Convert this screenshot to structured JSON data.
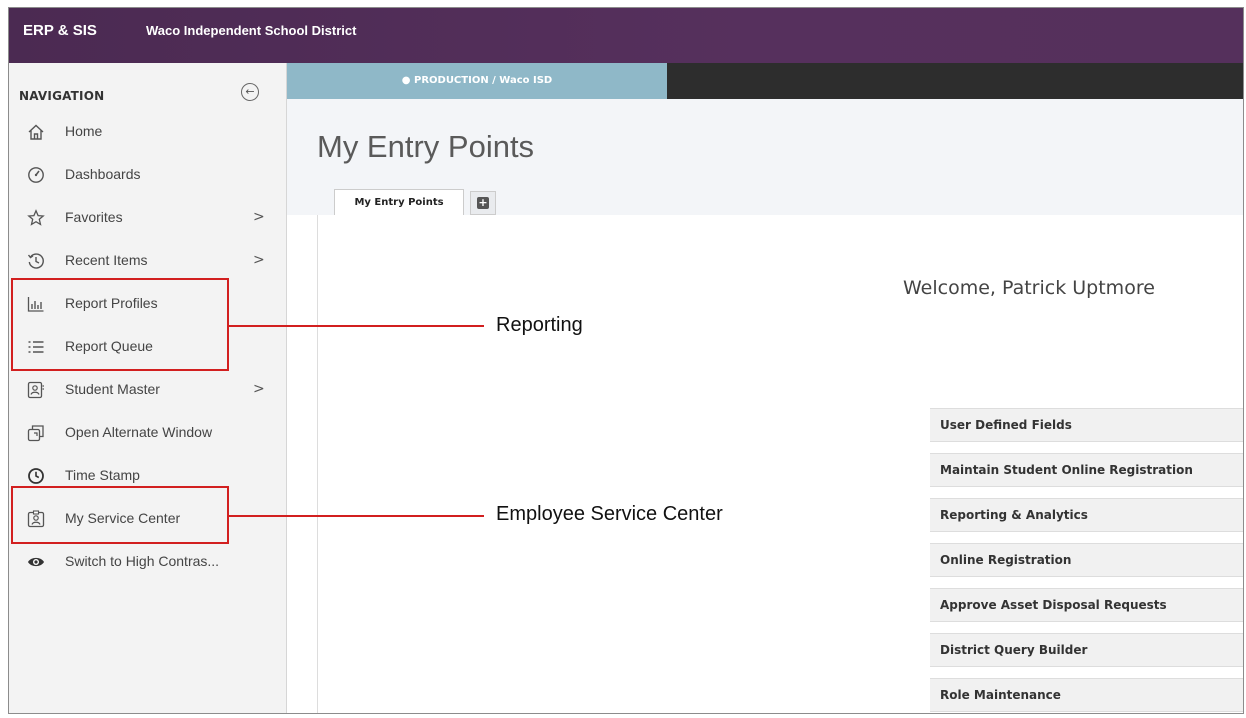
{
  "topbar": {
    "app_name": "ERP & SIS",
    "district": "Waco Independent School District"
  },
  "sidebar": {
    "heading": "NAVIGATION",
    "collapse_icon": "circle-arrow-left-icon",
    "items": [
      {
        "label": "Home",
        "icon": "home-icon",
        "chevron": ""
      },
      {
        "label": "Dashboards",
        "icon": "dashboard-gauge-icon",
        "chevron": ""
      },
      {
        "label": "Favorites",
        "icon": "star-icon",
        "chevron": ">"
      },
      {
        "label": "Recent Items",
        "icon": "history-icon",
        "chevron": ">"
      },
      {
        "label": "Report Profiles",
        "icon": "bar-chart-icon",
        "chevron": ""
      },
      {
        "label": "Report Queue",
        "icon": "list-icon",
        "chevron": ""
      },
      {
        "label": "Student Master",
        "icon": "student-card-icon",
        "chevron": ">"
      },
      {
        "label": "Open Alternate Window",
        "icon": "new-window-icon",
        "chevron": ""
      },
      {
        "label": "Time Stamp",
        "icon": "clock-icon",
        "chevron": ""
      },
      {
        "label": "My Service Center",
        "icon": "person-badge-icon",
        "chevron": ""
      },
      {
        "label": "Switch to High Contras...",
        "icon": "eye-icon",
        "chevron": ""
      }
    ]
  },
  "main": {
    "environment": "PRODUCTION / Waco ISD",
    "page_title": "My Entry Points",
    "tabs": [
      {
        "label": "My Entry Points"
      }
    ],
    "add_tab_icon": "plus-square-icon",
    "welcome": "Welcome, Patrick Uptmore",
    "entry_points": [
      "User Defined Fields",
      "Maintain Student Online Registration",
      "Reporting & Analytics",
      "Online Registration",
      "Approve Asset Disposal Requests",
      "District Query Builder",
      "Role Maintenance"
    ]
  },
  "annotations": {
    "reporting": "Reporting",
    "service_center": "Employee Service Center",
    "color": "#d21f1f"
  }
}
